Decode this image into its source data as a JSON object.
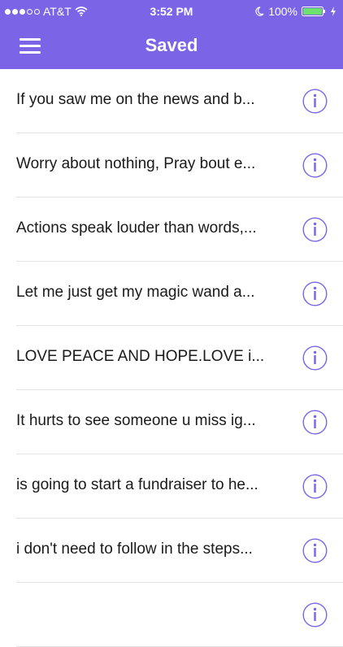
{
  "status_bar": {
    "carrier": "AT&T",
    "time": "3:52 PM",
    "battery": "100%"
  },
  "nav": {
    "title": "Saved"
  },
  "items": [
    {
      "text": "If you saw me on the news and b..."
    },
    {
      "text": "Worry about nothing, Pray bout e..."
    },
    {
      "text": "Actions speak louder than words,..."
    },
    {
      "text": "Let me just get my magic wand a..."
    },
    {
      "text": "LOVE PEACE AND HOPE.LOVE i..."
    },
    {
      "text": "It hurts to see someone u miss ig..."
    },
    {
      "text": "is going to start a fundraiser to he..."
    },
    {
      "text": "i don't need to follow in the steps..."
    },
    {
      "text": ""
    }
  ],
  "colors": {
    "header": "#7b64e6",
    "accent": "#7b64e6"
  },
  "icons": {
    "menu": "hamburger-icon",
    "info": "info-circle-icon"
  }
}
